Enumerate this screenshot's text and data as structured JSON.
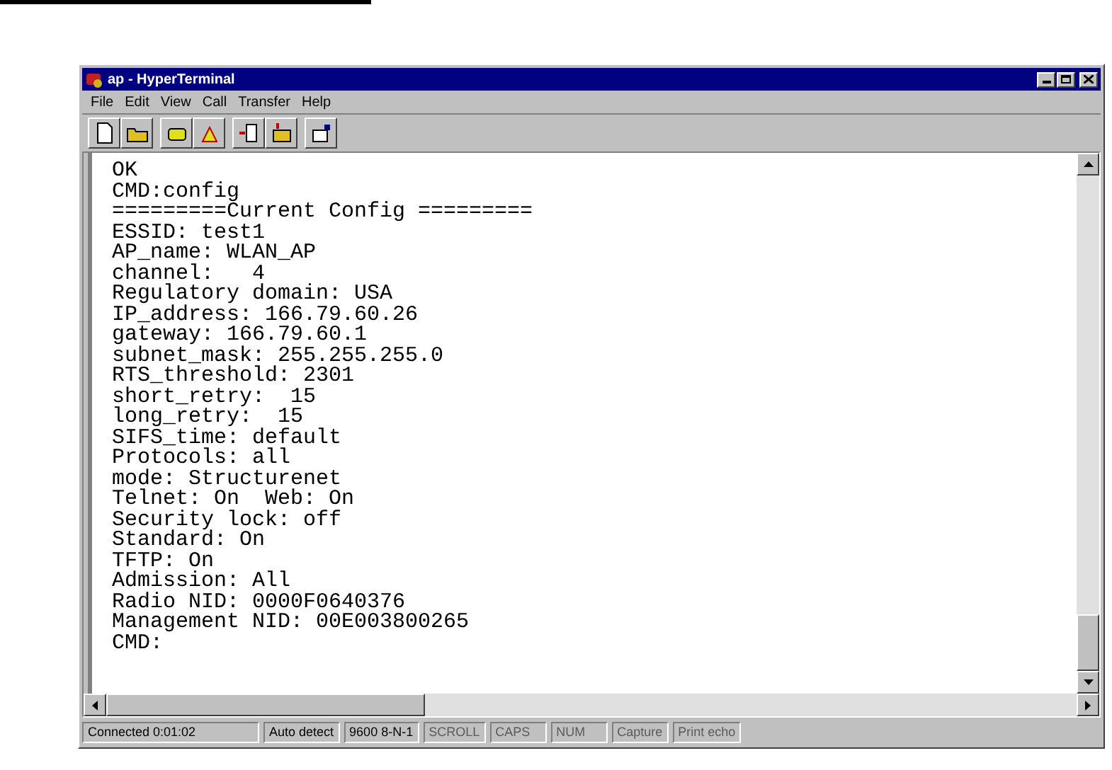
{
  "window": {
    "title": "ap - HyperTerminal"
  },
  "menu": [
    "File",
    "Edit",
    "View",
    "Call",
    "Transfer",
    "Help"
  ],
  "terminal": {
    "lines": [
      "OK",
      "CMD:config",
      "=========Current Config =========",
      "ESSID: test1",
      "AP_name: WLAN_AP",
      "channel:   4",
      "Regulatory domain: USA",
      "IP_address: 166.79.60.26",
      "gateway: 166.79.60.1",
      "subnet_mask: 255.255.255.0",
      "RTS_threshold: 2301",
      "short_retry:  15",
      "long_retry:  15",
      "SIFS_time: default",
      "Protocols: all",
      "mode: Structurenet",
      "Telnet: On  Web: On",
      "Security lock: off",
      "Standard: On",
      "TFTP: On",
      "Admission: All",
      "Radio NID: 0000F0640376",
      "Management NID: 00E003800265",
      "CMD:"
    ]
  },
  "status_bar": [
    {
      "text": "Connected 0:01:02",
      "disabled": false
    },
    {
      "text": "Auto detect",
      "disabled": false
    },
    {
      "text": "9600 8-N-1",
      "disabled": false
    },
    {
      "text": "SCROLL",
      "disabled": true
    },
    {
      "text": "CAPS",
      "disabled": true
    },
    {
      "text": "NUM",
      "disabled": true
    },
    {
      "text": "Capture",
      "disabled": true
    },
    {
      "text": "Print echo",
      "disabled": true
    }
  ]
}
